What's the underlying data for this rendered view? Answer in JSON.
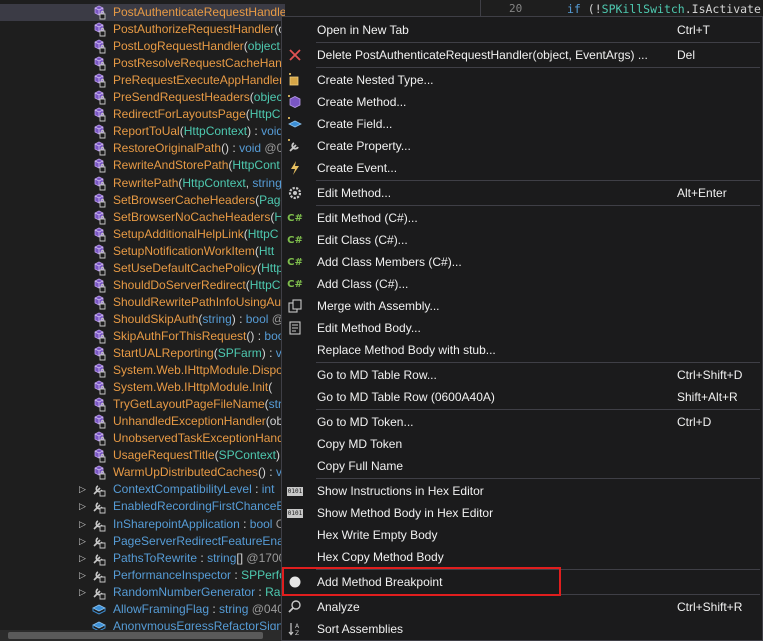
{
  "tree": {
    "rows": [
      {
        "kind": "method",
        "name": "PostAuthenticateRequestHandler",
        "rest": [
          [
            "p",
            "("
          ],
          [
            "t",
            "object"
          ],
          [
            "p",
            ", "
          ],
          [
            "t",
            "EventArgs"
          ],
          [
            "p",
            ") : "
          ],
          [
            "k",
            "void"
          ],
          [
            "g",
            " @06"
          ]
        ],
        "selected": true
      },
      {
        "kind": "method",
        "name": "PostAuthorizeRequestHandler",
        "rest": [
          [
            "p",
            "(o"
          ]
        ]
      },
      {
        "kind": "method",
        "name": "PostLogRequestHandler",
        "rest": [
          [
            "p",
            "("
          ],
          [
            "t",
            "object"
          ],
          [
            "p",
            ", "
          ]
        ]
      },
      {
        "kind": "method",
        "name": "PostResolveRequestCacheHand",
        "rest": []
      },
      {
        "kind": "method",
        "name": "PreRequestExecuteAppHandler",
        "rest": [
          [
            "p",
            "("
          ]
        ]
      },
      {
        "kind": "method",
        "name": "PreSendRequestHeaders",
        "rest": [
          [
            "p",
            "("
          ],
          [
            "t",
            "object"
          ],
          [
            "p",
            ", "
          ]
        ]
      },
      {
        "kind": "method",
        "name": "RedirectForLayoutsPage",
        "rest": [
          [
            "p",
            "("
          ],
          [
            "t",
            "HttpCo"
          ]
        ]
      },
      {
        "kind": "method",
        "name": "ReportToUal",
        "rest": [
          [
            "p",
            "("
          ],
          [
            "t",
            "HttpContext"
          ],
          [
            "p",
            ") : "
          ],
          [
            "k",
            "void"
          ]
        ]
      },
      {
        "kind": "method",
        "name": "RestoreOriginalPath",
        "rest": [
          [
            "p",
            "() : "
          ],
          [
            "k",
            "void"
          ],
          [
            "g",
            " @06"
          ]
        ]
      },
      {
        "kind": "method",
        "name": "RewriteAndStorePath",
        "rest": [
          [
            "p",
            "("
          ],
          [
            "t",
            "HttpCont"
          ]
        ]
      },
      {
        "kind": "method",
        "name": "RewritePath",
        "rest": [
          [
            "p",
            "("
          ],
          [
            "t",
            "HttpContext"
          ],
          [
            "p",
            ", "
          ],
          [
            "k",
            "string"
          ]
        ]
      },
      {
        "kind": "method",
        "name": "SetBrowserCacheHeaders",
        "rest": [
          [
            "p",
            "("
          ],
          [
            "t",
            "Page"
          ],
          [
            "p",
            ","
          ]
        ]
      },
      {
        "kind": "method",
        "name": "SetBrowserNoCacheHeaders",
        "rest": [
          [
            "p",
            "("
          ],
          [
            "t",
            "Ht"
          ]
        ]
      },
      {
        "kind": "method",
        "name": "SetupAdditionalHelpLink",
        "rest": [
          [
            "p",
            "("
          ],
          [
            "t",
            "HttpC"
          ]
        ]
      },
      {
        "kind": "method",
        "name": "SetupNotificationWorkItem",
        "rest": [
          [
            "p",
            "("
          ],
          [
            "t",
            "Htt"
          ]
        ]
      },
      {
        "kind": "method",
        "name": "SetUseDefaultCachePolicy",
        "rest": [
          [
            "p",
            "("
          ],
          [
            "t",
            "Http"
          ]
        ]
      },
      {
        "kind": "method",
        "name": "ShouldDoServerRedirect",
        "rest": [
          [
            "p",
            "("
          ],
          [
            "t",
            "HttpCo"
          ]
        ]
      },
      {
        "kind": "method",
        "name": "ShouldRewritePathInfoUsingAu",
        "rest": []
      },
      {
        "kind": "method",
        "name": "ShouldSkipAuth",
        "rest": [
          [
            "p",
            "("
          ],
          [
            "k",
            "string"
          ],
          [
            "p",
            ") : "
          ],
          [
            "k",
            "bool"
          ],
          [
            "g",
            " @"
          ]
        ]
      },
      {
        "kind": "method",
        "name": "SkipAuthForThisRequest",
        "rest": [
          [
            "p",
            "() : "
          ],
          [
            "k",
            "boo"
          ]
        ]
      },
      {
        "kind": "method",
        "name": "StartUALReporting",
        "rest": [
          [
            "p",
            "("
          ],
          [
            "t",
            "SPFarm"
          ],
          [
            "p",
            ") : "
          ],
          [
            "k",
            "vo"
          ]
        ]
      },
      {
        "kind": "method",
        "name": "System.Web.IHttpModule.Dispo",
        "rest": []
      },
      {
        "kind": "method",
        "name": "System.Web.IHttpModule.Init",
        "rest": [
          [
            "p",
            "("
          ]
        ]
      },
      {
        "kind": "method",
        "name": "TryGetLayoutPageFileName",
        "rest": [
          [
            "p",
            "("
          ],
          [
            "k",
            "strin"
          ]
        ]
      },
      {
        "kind": "method",
        "name": "UnhandledExceptionHandler",
        "rest": [
          [
            "p",
            "(ob"
          ]
        ]
      },
      {
        "kind": "method",
        "name": "UnobservedTaskExceptionHand",
        "rest": []
      },
      {
        "kind": "method",
        "name": "UsageRequestTitle",
        "rest": [
          [
            "p",
            "("
          ],
          [
            "t",
            "SPContext"
          ],
          [
            "p",
            ") : "
          ]
        ]
      },
      {
        "kind": "method",
        "name": "WarmUpDistributedCaches",
        "rest": [
          [
            "p",
            "() : "
          ],
          [
            "k",
            "v"
          ]
        ]
      },
      {
        "kind": "prop",
        "name": "ContextCompatibilityLevel",
        "rest": [
          [
            "p",
            " : "
          ],
          [
            "k",
            "int"
          ]
        ],
        "expand": true
      },
      {
        "kind": "prop",
        "name": "EnabledRecordingFirstChanceEx",
        "rest": [],
        "expand": true
      },
      {
        "kind": "prop",
        "name": "InSharepointApplication",
        "rest": [
          [
            "p",
            " : "
          ],
          [
            "k",
            "bool"
          ],
          [
            "g",
            " C"
          ]
        ],
        "expand": true
      },
      {
        "kind": "prop",
        "name": "PageServerRedirectFeatureEnab",
        "rest": [],
        "expand": true
      },
      {
        "kind": "prop",
        "name": "PathsToRewrite",
        "rest": [
          [
            "p",
            " : "
          ],
          [
            "k",
            "string"
          ],
          [
            "p",
            "[] "
          ],
          [
            "g",
            "@1700"
          ]
        ],
        "expand": true
      },
      {
        "kind": "prop",
        "name": "PerformanceInspector",
        "rest": [
          [
            "p",
            " : "
          ],
          [
            "t",
            "SPPerfo"
          ]
        ],
        "expand": true
      },
      {
        "kind": "prop",
        "name": "RandomNumberGenerator",
        "rest": [
          [
            "p",
            " : "
          ],
          [
            "t",
            "Ran"
          ]
        ],
        "expand": true
      },
      {
        "kind": "field",
        "name": "AllowFramingFlag",
        "rest": [
          [
            "p",
            " : "
          ],
          [
            "k",
            "string"
          ],
          [
            "g",
            " @040"
          ]
        ]
      },
      {
        "kind": "field",
        "name": "AnonymousEgressRefactorSign",
        "rest": []
      }
    ]
  },
  "code": {
    "line_number": "20",
    "keyword_if": "if",
    "open": " (!",
    "type": "SPKillSwitch",
    "member": ".IsActivate"
  },
  "menu": {
    "items": [
      {
        "icon": "none",
        "label": "Open in New Tab",
        "shortcut": "Ctrl+T"
      },
      {
        "sep": true
      },
      {
        "icon": "delete-icon",
        "label": "Delete PostAuthenticateRequestHandler(object, EventArgs) ...",
        "shortcut": "Del"
      },
      {
        "sep": true
      },
      {
        "icon": "create-nested-type-icon",
        "label": "Create Nested Type...",
        "shortcut": ""
      },
      {
        "icon": "create-method-icon",
        "label": "Create Method...",
        "shortcut": ""
      },
      {
        "icon": "create-field-icon",
        "label": "Create Field...",
        "shortcut": ""
      },
      {
        "icon": "create-property-icon",
        "label": "Create Property...",
        "shortcut": ""
      },
      {
        "icon": "create-event-icon",
        "label": "Create Event...",
        "shortcut": ""
      },
      {
        "sep": true
      },
      {
        "icon": "settings-icon",
        "label": "Edit Method...",
        "shortcut": "Alt+Enter"
      },
      {
        "sep": true
      },
      {
        "icon": "csharp-icon",
        "label": "Edit Method (C#)...",
        "shortcut": ""
      },
      {
        "icon": "csharp-icon",
        "label": "Edit Class (C#)...",
        "shortcut": ""
      },
      {
        "icon": "csharp-icon",
        "label": "Add Class Members (C#)...",
        "shortcut": ""
      },
      {
        "icon": "csharp-icon",
        "label": "Add Class (C#)...",
        "shortcut": ""
      },
      {
        "icon": "merge-icon",
        "label": "Merge with Assembly...",
        "shortcut": ""
      },
      {
        "icon": "edit-body-icon",
        "label": "Edit Method Body...",
        "shortcut": ""
      },
      {
        "icon": "none",
        "label": "Replace Method Body with stub...",
        "shortcut": ""
      },
      {
        "sep": true
      },
      {
        "icon": "none",
        "label": "Go to MD Table Row...",
        "shortcut": "Ctrl+Shift+D"
      },
      {
        "icon": "none",
        "label": "Go to MD Table Row (0600A40A)",
        "shortcut": "Shift+Alt+R"
      },
      {
        "sep": true
      },
      {
        "icon": "none",
        "label": "Go to MD Token...",
        "shortcut": "Ctrl+D"
      },
      {
        "icon": "none",
        "label": "Copy MD Token",
        "shortcut": ""
      },
      {
        "icon": "none",
        "label": "Copy Full Name",
        "shortcut": ""
      },
      {
        "sep": true
      },
      {
        "icon": "hex-icon",
        "label": "Show Instructions in Hex Editor",
        "shortcut": ""
      },
      {
        "icon": "hex-icon",
        "label": "Show Method Body in Hex Editor",
        "shortcut": ""
      },
      {
        "icon": "none",
        "label": "Hex Write Empty Body",
        "shortcut": ""
      },
      {
        "icon": "none",
        "label": "Hex Copy Method Body",
        "shortcut": ""
      },
      {
        "sep": true
      },
      {
        "icon": "breakpoint-icon",
        "label": "Add Method Breakpoint",
        "shortcut": ""
      },
      {
        "sep": true
      },
      {
        "icon": "analyze-icon",
        "label": "Analyze",
        "shortcut": "Ctrl+Shift+R"
      },
      {
        "icon": "sort-icon",
        "label": "Sort Assemblies",
        "shortcut": ""
      }
    ],
    "csharp_glyph": "C#",
    "hex_glyph": "0101"
  },
  "colors": {
    "highlight_border": "#e01e1e",
    "menu_bg": "#1b1b1c",
    "method_text": "#e79a45",
    "prop_text": "#569cd6"
  }
}
